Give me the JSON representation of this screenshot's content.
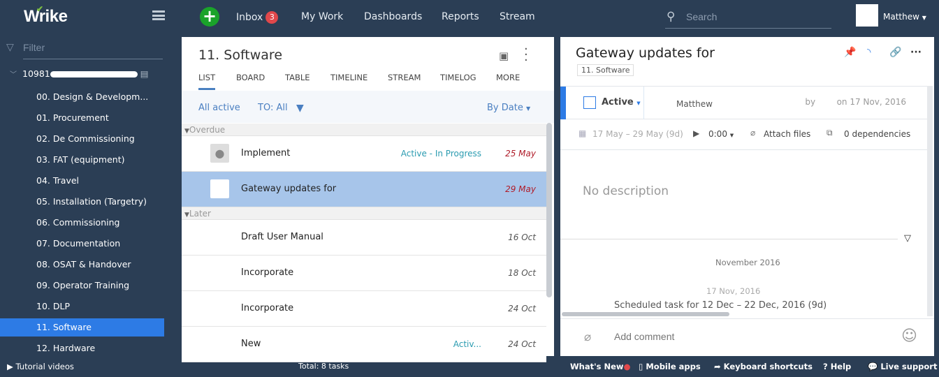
{
  "topbar": {
    "logo": "Wrike",
    "nav": [
      {
        "label": "Inbox",
        "badge": "3"
      },
      {
        "label": "My Work"
      },
      {
        "label": "Dashboards"
      },
      {
        "label": "Reports"
      },
      {
        "label": "Stream"
      }
    ],
    "search_placeholder": "Search",
    "user": "Matthew"
  },
  "sidebar": {
    "filter_placeholder": "Filter",
    "root": "10981",
    "items": [
      "00. Design & Developm...",
      "01. Procurement",
      "02. De Commissioning",
      "03. FAT (equipment)",
      "04. Travel",
      "05. Installation (Targetry)",
      "06. Commissioning",
      "07. Documentation",
      "08. OSAT & Handover",
      "09. Operator Training",
      "10. DLP",
      "11. Software",
      "12. Hardware"
    ],
    "selected": "11. Software"
  },
  "list": {
    "title": "11. Software",
    "tabs": [
      "LIST",
      "BOARD",
      "TABLE",
      "TIMELINE",
      "STREAM",
      "TIMELOG",
      "MORE"
    ],
    "active_tab": "LIST",
    "filter_status": "All active",
    "filter_to": "TO: All",
    "sort": "By Date",
    "groups": [
      {
        "label": "Overdue",
        "rows": [
          {
            "name": "Implement",
            "status": "Active - In Progress",
            "date": "25 May",
            "overdue": true,
            "avatar": "person"
          },
          {
            "name": "Gateway updates for",
            "status": "",
            "date": "29 May",
            "overdue": true,
            "selected": true
          }
        ]
      },
      {
        "label": "Later",
        "rows": [
          {
            "name": "Draft User Manual",
            "status": "",
            "date": "16 Oct"
          },
          {
            "name": "Incorporate",
            "status": "",
            "date": "18 Oct"
          },
          {
            "name": "Incorporate",
            "status": "",
            "date": "24 Oct"
          },
          {
            "name": "New",
            "status": "Activ...",
            "date": "24 Oct"
          }
        ]
      }
    ],
    "total": "Total: 8 tasks"
  },
  "task": {
    "title": "Gateway updates for",
    "folder": "11. Software",
    "status": "Active",
    "assignee": "Matthew",
    "created": "by        on 17 Nov, 2016",
    "dates": "17 May – 29 May (9d)",
    "timer": "0:00",
    "attach": "Attach files",
    "deps": "0 dependencies",
    "description": "No description",
    "month": "November 2016",
    "log_date": "17 Nov, 2016",
    "log_text": "Scheduled task for 12 Dec – 22 Dec, 2016 (9d)",
    "comment_placeholder": "Add comment",
    "accent": "#2d7be5"
  },
  "footer": {
    "tutorial": "Tutorial videos",
    "whats_new": "What's New",
    "mobile": "Mobile apps",
    "shortcuts": "Keyboard shortcuts",
    "help": "Help",
    "support": "Live support"
  }
}
